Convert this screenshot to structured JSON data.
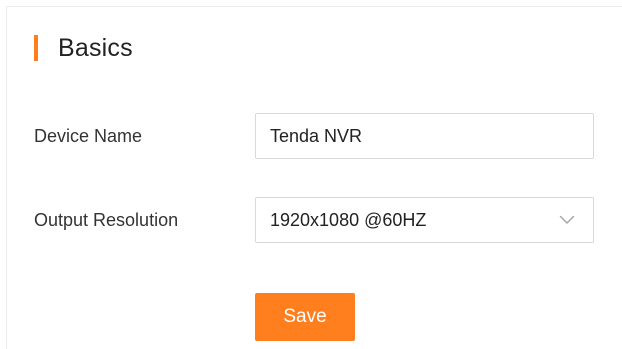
{
  "section": {
    "title": "Basics"
  },
  "device_name": {
    "label": "Device Name",
    "value": "Tenda NVR"
  },
  "output_resolution": {
    "label": "Output Resolution",
    "selected": "1920x1080 @60HZ",
    "icon": "chevron-down-icon"
  },
  "actions": {
    "save_label": "Save"
  },
  "colors": {
    "accent": "#ff7f1e",
    "border": "#d9d9d9",
    "text": "#333333"
  }
}
